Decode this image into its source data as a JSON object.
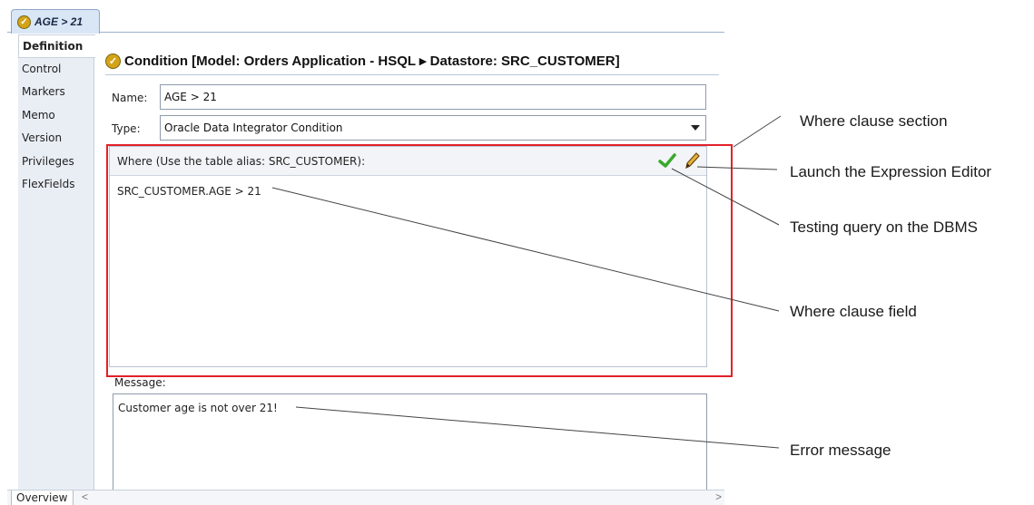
{
  "tab": {
    "label": "AGE > 21"
  },
  "nav": {
    "items": [
      "Definition",
      "Control",
      "Markers",
      "Memo",
      "Version",
      "Privileges",
      "FlexFields"
    ],
    "active_index": 0
  },
  "form": {
    "title": "Condition [Model: Orders Application - HSQL ▸ Datastore: SRC_CUSTOMER]",
    "name_label": "Name:",
    "name_value": "AGE > 21",
    "type_label": "Type:",
    "type_value": "Oracle Data Integrator Condition",
    "where_label": "Where (Use the table alias: SRC_CUSTOMER):",
    "where_value": "SRC_CUSTOMER.AGE > 21",
    "message_label": "Message:",
    "message_value": "Customer age is not over 21!"
  },
  "bottom": {
    "tab_label": "Overview"
  },
  "annotations": {
    "where_section": "Where clause section",
    "expression_editor": "Launch the Expression Editor",
    "testing_query": "Testing query on the DBMS",
    "where_field": "Where clause field",
    "error_message": "Error message"
  },
  "icons": {
    "check_badge": "check-circle-icon",
    "test_query": "checkmark-icon",
    "expression_editor": "pencil-icon"
  },
  "colors": {
    "highlight": "#e3202a",
    "check_green": "#3aa82e",
    "badge_gold": "#d4a418"
  }
}
